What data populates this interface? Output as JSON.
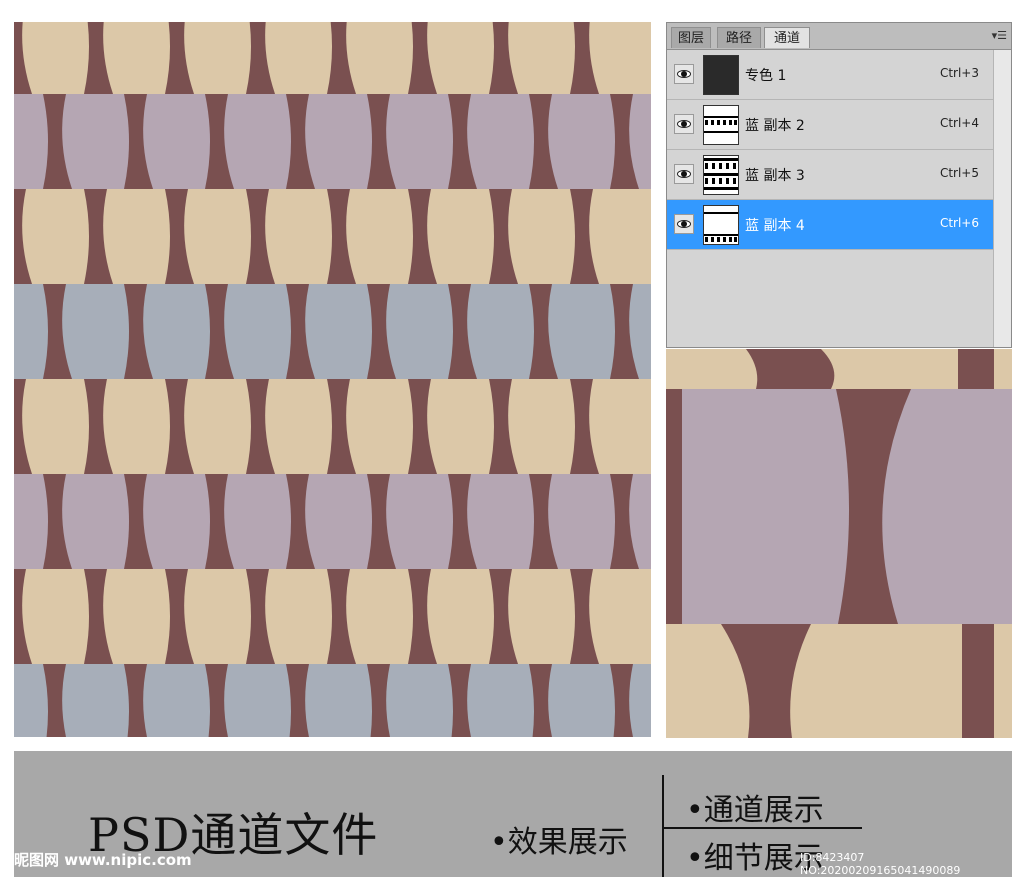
{
  "panel": {
    "tabs": [
      {
        "label": "图层"
      },
      {
        "label": "路径"
      },
      {
        "label": "通道"
      }
    ],
    "menu_icon": "panel-menu-icon",
    "channels": [
      {
        "name": "专色 1",
        "shortcut": "Ctrl+3",
        "selected": false,
        "visible": true
      },
      {
        "name": "蓝 副本 2",
        "shortcut": "Ctrl+4",
        "selected": false,
        "visible": true
      },
      {
        "name": "蓝 副本 3",
        "shortcut": "Ctrl+5",
        "selected": false,
        "visible": true
      },
      {
        "name": "蓝 副本 4",
        "shortcut": "Ctrl+6",
        "selected": true,
        "visible": true
      }
    ]
  },
  "banner": {
    "title": "PSD通道文件",
    "effect_label": "•效果展示",
    "channel_label": "•通道展示",
    "detail_label": "•细节展示",
    "watermark": "昵图网 www.nipic.com",
    "id_text": "ID:8423407 NO:20200209165041490089"
  },
  "colors": {
    "ground": "#7a5050",
    "beige": "#dcc8a8",
    "mauve": "#b5a6b3",
    "blue_gray": "#a7aeb9",
    "selection": "#3399ff"
  }
}
